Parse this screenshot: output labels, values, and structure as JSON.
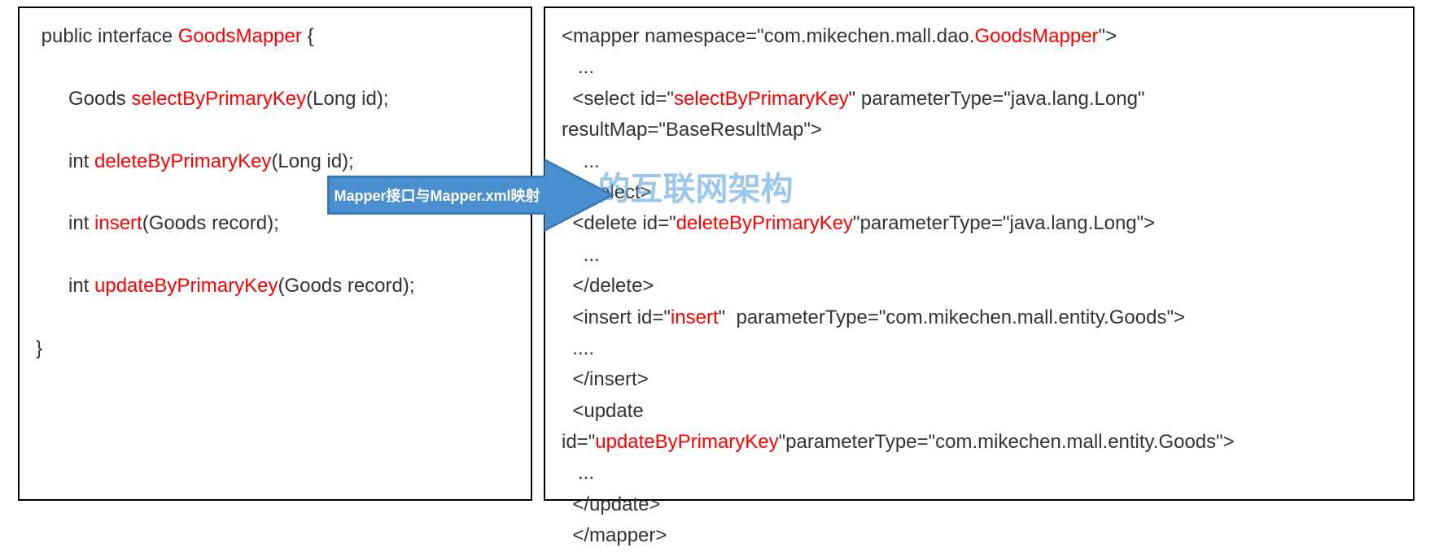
{
  "watermark": "mikechen的互联网架构",
  "arrow": {
    "label": "Mapper接口与Mapper.xml映射"
  },
  "left": {
    "l1a": " public interface ",
    "l1b": "GoodsMapper",
    "l1c": " {",
    "l2a": "Goods ",
    "l2b": "selectByPrimaryKey",
    "l2c": "(Long id);",
    "l3a": "int ",
    "l3b": "deleteByPrimaryKey",
    "l3c": "(Long id);",
    "l4a": "int ",
    "l4b": "insert",
    "l4c": "(Goods record);",
    "l5a": "int ",
    "l5b": "updateByPrimaryKey",
    "l5c": "(Goods record);",
    "l6": "}"
  },
  "right": {
    "r1a": "<mapper namespace=\"com.mikechen.mall.dao.",
    "r1b": "GoodsMapper",
    "r1c": "\">",
    "r2": "   ...",
    "r3a": "  <select id=\"",
    "r3b": "selectByPrimaryKey",
    "r3c": "\" parameterType=\"java.lang.Long\"",
    "r4": "resultMap=\"BaseResultMap\">",
    "r5": "    ...",
    "r6": "  </select>",
    "r7a": "  <delete id=\"",
    "r7b": "deleteByPrimaryKey",
    "r7c": "\"parameterType=\"java.lang.Long\">",
    "r8": "    ...",
    "r9": "  </delete>",
    "r10a": "  <insert id=\"",
    "r10b": "insert",
    "r10c": "\"  parameterType=\"com.mikechen.mall.entity.Goods\">",
    "r11": "  ....",
    "r12": "  </insert>",
    "r13": "",
    "r14": "  <update",
    "r15a": "id=\"",
    "r15b": "updateByPrimaryKey",
    "r15c": "\"parameterType=\"com.mikechen.mall.entity.Goods\">",
    "r16": "   ...",
    "r17": "  </update>",
    "r18": "  </mapper>"
  }
}
